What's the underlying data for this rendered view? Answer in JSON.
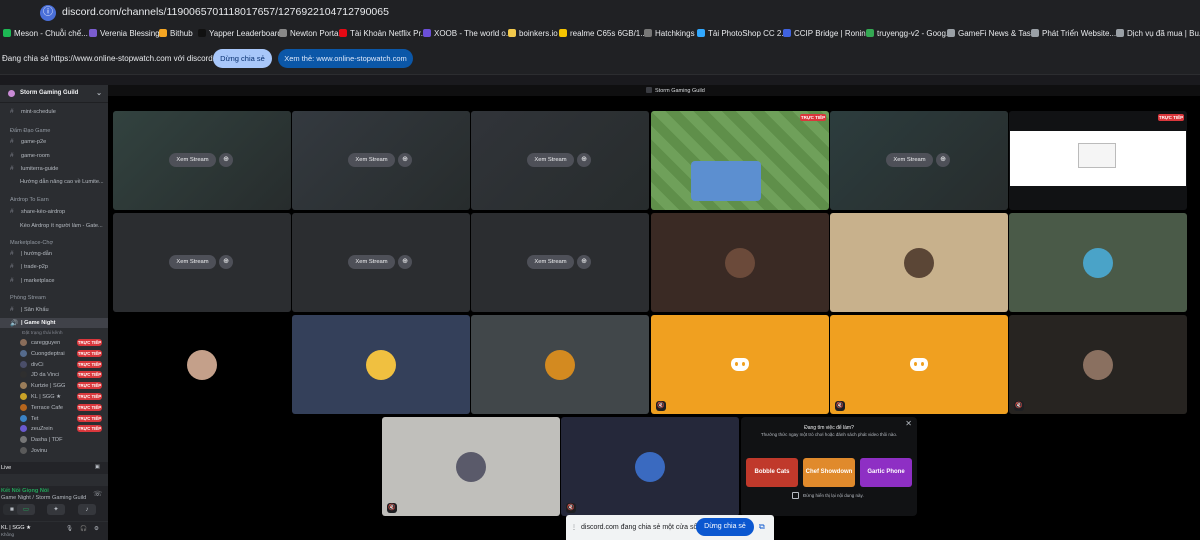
{
  "browser": {
    "url": "discord.com/channels/1190065701118017657/1276922104712790065",
    "bookmarks": [
      {
        "label": "Meson - Chuỗi chế...",
        "color": "#1db954"
      },
      {
        "label": "Verenia Blessings",
        "color": "#7a5ccf"
      },
      {
        "label": "Bithub",
        "color": "#f5a623"
      },
      {
        "label": "Yapper Leaderboard",
        "color": "#111111"
      },
      {
        "label": "Newton Portal",
        "color": "#888888"
      },
      {
        "label": "Tài Khoản Netflix Pr...",
        "color": "#e50914"
      },
      {
        "label": "XOOB - The world o...",
        "color": "#6b4fd8"
      },
      {
        "label": "boinkers.io",
        "color": "#f2c94c"
      },
      {
        "label": "realme C65s 6GB/1...",
        "color": "#f5c400"
      },
      {
        "label": "Hatchkings",
        "color": "#777777"
      },
      {
        "label": "Tải PhotoShop CC 2...",
        "color": "#31a8ff"
      },
      {
        "label": "CCIP Bridge | Ronin...",
        "color": "#3f62e0"
      },
      {
        "label": "truyengg-v2 - Goog...",
        "color": "#34a853"
      },
      {
        "label": "GameFi News & Tas...",
        "color": "#9aa0a6"
      },
      {
        "label": "Phát Triển Website...",
        "color": "#9aa0a6"
      },
      {
        "label": "Dịch vụ đã mua | Bu...",
        "color": "#9aa0a6"
      }
    ]
  },
  "share_banner": {
    "message": "Đang chia sẻ https://www.online-stopwatch.com với discord.com",
    "stop_label": "Dừng chia sẻ",
    "view_label": "Xem thẻ: www.online-stopwatch.com"
  },
  "sidebar": {
    "server_name": "Storm Gaming Guild",
    "rows": [
      {
        "kind": "chan",
        "label": "mint-schedule"
      },
      {
        "kind": "cat",
        "label": "Đấm Đạo Game"
      },
      {
        "kind": "chan",
        "label": "game-p2e"
      },
      {
        "kind": "chan",
        "label": "game-room"
      },
      {
        "kind": "chan",
        "label": "lumiterra-guide"
      },
      {
        "kind": "sub",
        "label": "Hướng dẫn nâng cao về Lumite..."
      },
      {
        "kind": "cat",
        "label": "Airdrop To Earn"
      },
      {
        "kind": "chan",
        "label": "share-kèo-airdrop"
      },
      {
        "kind": "sub",
        "label": "Kèo Airdrop ít người làm - Gate..."
      },
      {
        "kind": "cat",
        "label": "Marketplace-Chợ"
      },
      {
        "kind": "chan",
        "label": "| hướng-dẫn"
      },
      {
        "kind": "chan",
        "label": "| trade-p2p"
      },
      {
        "kind": "chan",
        "label": "| marketplace"
      },
      {
        "kind": "cat",
        "label": "Phòng Stream"
      },
      {
        "kind": "chan",
        "label": "| Sân Khấu"
      },
      {
        "kind": "sel",
        "label": "| Game Night"
      }
    ],
    "voice_status": "Đặt trạng thái kênh",
    "members": [
      {
        "name": "caregguyen",
        "color": "#8a6d5a",
        "live": true
      },
      {
        "name": "Cuongdeptrai",
        "color": "#556b8d",
        "live": true
      },
      {
        "name": "divCi",
        "color": "#4a4e69",
        "live": true
      },
      {
        "name": "JD da Vinci",
        "color": "#2f2f2f",
        "live": true
      },
      {
        "name": "Kurtzie | SGG",
        "color": "#9a7d5a",
        "live": true
      },
      {
        "name": "KL | SGG ★",
        "color": "#c9a227",
        "live": true
      },
      {
        "name": "Terrace Cafe",
        "color": "#b5651d",
        "live": true
      },
      {
        "name": "Tet",
        "color": "#3b82c4",
        "live": true
      },
      {
        "name": "zeuZrein",
        "color": "#6a5acd",
        "live": true
      },
      {
        "name": "Dasha | TDF",
        "color": "#777777",
        "live": false
      },
      {
        "name": "Jovinu",
        "color": "#5a5a5a",
        "live": false
      }
    ],
    "live_label": "TRỰC TIẾP",
    "live_strip": "Live",
    "voice_connected": "Kết Nối Giọng Nói",
    "voice_channel": "Game Night / Storm Gaming Guild",
    "user_name": "KL | SGG ★",
    "user_sub": "Không"
  },
  "grid": {
    "header": "Storm Gaming Guild",
    "watch_label": "Xem Stream",
    "live_label": "TRỰC TIẾP"
  },
  "promo": {
    "heading": "Đang tìm việc để làm?",
    "subtitle": "Thưởng thức ngay một trò chơi hoặc đánh sách phát video thôi nào.",
    "games": [
      "Bobble Cats",
      "Chef Showdown",
      "Gartic Phone"
    ],
    "checkbox_label": "Đừng hiển thị lại nội dung này."
  },
  "share_pill": {
    "text": "discord.com đang chia sẻ một cửa sổ.",
    "button": "Dừng chia sẻ"
  }
}
